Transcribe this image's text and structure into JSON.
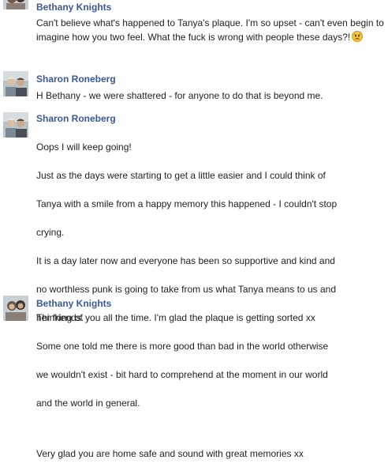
{
  "comments": [
    {
      "author": "Bethany Knights",
      "text": "Can't believe what's happened to Tanya's plaque. I'm so upset - can't even begin to imagine how you two feel. What the fuck is wrong with people these days?!",
      "emoji": "angry-face-icon"
    },
    {
      "author": "Sharon Roneberg",
      "text": "H Bethany - we were shattered - for anyone to do that is beyond me."
    },
    {
      "author": "Sharon Roneberg",
      "lines": [
        "Oops I will keep going!",
        "Just as the days were starting to get a little easier and I could think of",
        "Tanya with a smile from a happy memory this happened - I couldn't stop",
        "crying.",
        "It is a day later now and everyone has been so supportive and kind and",
        "no worthless punk is going to take from us what Tanya means to us and",
        "her friends.",
        "Some one told me there is more good than bad in the world otherwise",
        "we wouldn't exist - bit hard to comprehend at the moment in our world",
        "and the world in general."
      ],
      "closing": "Very glad you are home safe and sound with great memories xx"
    },
    {
      "author": "Bethany Knights",
      "text": "Thinking of you all the time. I'm glad the plaque is getting sorted xx"
    }
  ],
  "colors": {
    "author_link": "#3b5998",
    "text": "#222222",
    "emoji_fill": "#f5c542"
  }
}
